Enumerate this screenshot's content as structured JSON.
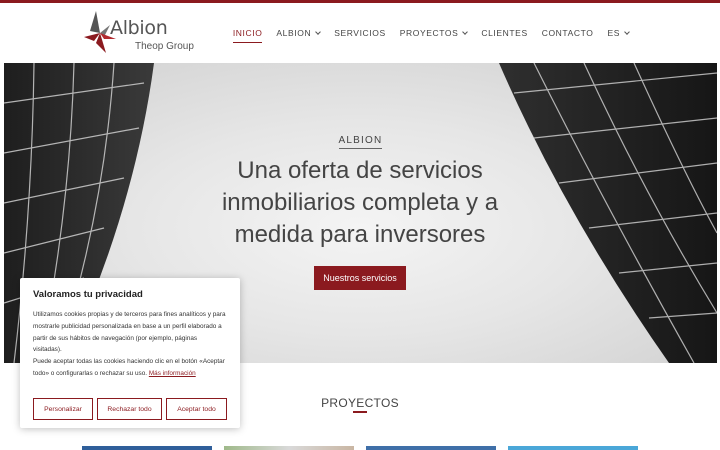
{
  "brand": {
    "name": "Albion",
    "tagline": "Theop Group",
    "accent_color": "#8b1a1f"
  },
  "nav": {
    "items": [
      {
        "label": "INICIO",
        "active": true,
        "dropdown": false
      },
      {
        "label": "ALBION",
        "active": false,
        "dropdown": true
      },
      {
        "label": "SERVICIOS",
        "active": false,
        "dropdown": false
      },
      {
        "label": "PROYECTOS",
        "active": false,
        "dropdown": true
      },
      {
        "label": "CLIENTES",
        "active": false,
        "dropdown": false
      },
      {
        "label": "CONTACTO",
        "active": false,
        "dropdown": false
      },
      {
        "label": "ES",
        "active": false,
        "dropdown": true
      }
    ]
  },
  "hero": {
    "tag": "ALBION",
    "title": "Una oferta de servicios inmobiliarios completa y a medida para inversores",
    "button": "Nuestros servicios"
  },
  "projects": {
    "title": "PROYECTOS"
  },
  "cookie": {
    "title": "Valoramos tu privacidad",
    "text": "Utilizamos cookies propias y de terceros para fines analíticos y para mostrarle publicidad personalizada en base a un perfil elaborado a partir de sus hábitos de navegación (por ejemplo, páginas visitadas).",
    "text2": "Puede aceptar todas las cookies haciendo clic en el botón «Aceptar todo» o configurarlas o rechazar su uso.",
    "link": "Más información",
    "buttons": {
      "customize": "Personalizar",
      "reject": "Rechazar todo",
      "accept": "Aceptar todo"
    }
  }
}
